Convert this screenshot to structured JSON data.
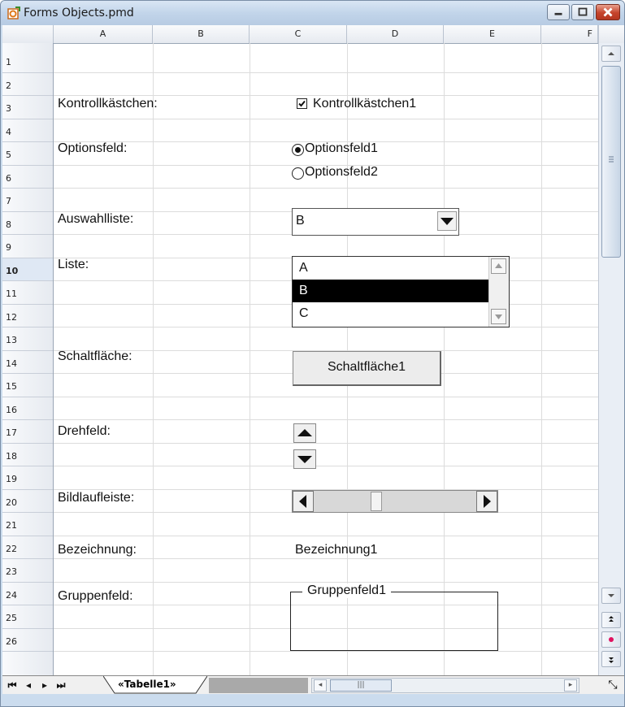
{
  "window": {
    "title": "Forms Objects.pmd",
    "buttons": {
      "minimize_icon": "minimize-icon",
      "maximize_icon": "maximize-icon",
      "close_icon": "close-icon"
    }
  },
  "columns": [
    "A",
    "B",
    "C",
    "D",
    "E",
    "F"
  ],
  "rows": [
    "1",
    "2",
    "3",
    "4",
    "5",
    "6",
    "7",
    "8",
    "9",
    "10",
    "11",
    "12",
    "13",
    "14",
    "15",
    "16",
    "17",
    "18",
    "19",
    "20",
    "21",
    "22",
    "23",
    "24",
    "25",
    "26"
  ],
  "selected_row": "10",
  "labels": {
    "checkbox": "Kontrollkästchen:",
    "option": "Optionsfeld:",
    "combo": "Auswahlliste:",
    "list": "Liste:",
    "button": "Schaltfläche:",
    "spin": "Drehfeld:",
    "scrollbar": "Bildlaufleiste:",
    "label": "Bezeichnung:",
    "group": "Gruppenfeld:"
  },
  "controls": {
    "checkbox": {
      "label": "Kontrollkästchen1",
      "checked": true
    },
    "options": [
      {
        "label": "Optionsfeld1",
        "selected": true
      },
      {
        "label": "Optionsfeld2",
        "selected": false
      }
    ],
    "combo": {
      "value": "B"
    },
    "list": {
      "items": [
        "A",
        "B",
        "C"
      ],
      "selected": "B"
    },
    "button": {
      "label": "Schaltfläche1"
    },
    "label": {
      "text": "Bezeichnung1"
    },
    "group": {
      "title": "Gruppenfeld1"
    }
  },
  "sheet_tabs": {
    "active": "«Tabelle1»"
  },
  "colors": {
    "selection": "#000000",
    "window_frame": "#cbdcee",
    "close_button": "#c5432b"
  }
}
